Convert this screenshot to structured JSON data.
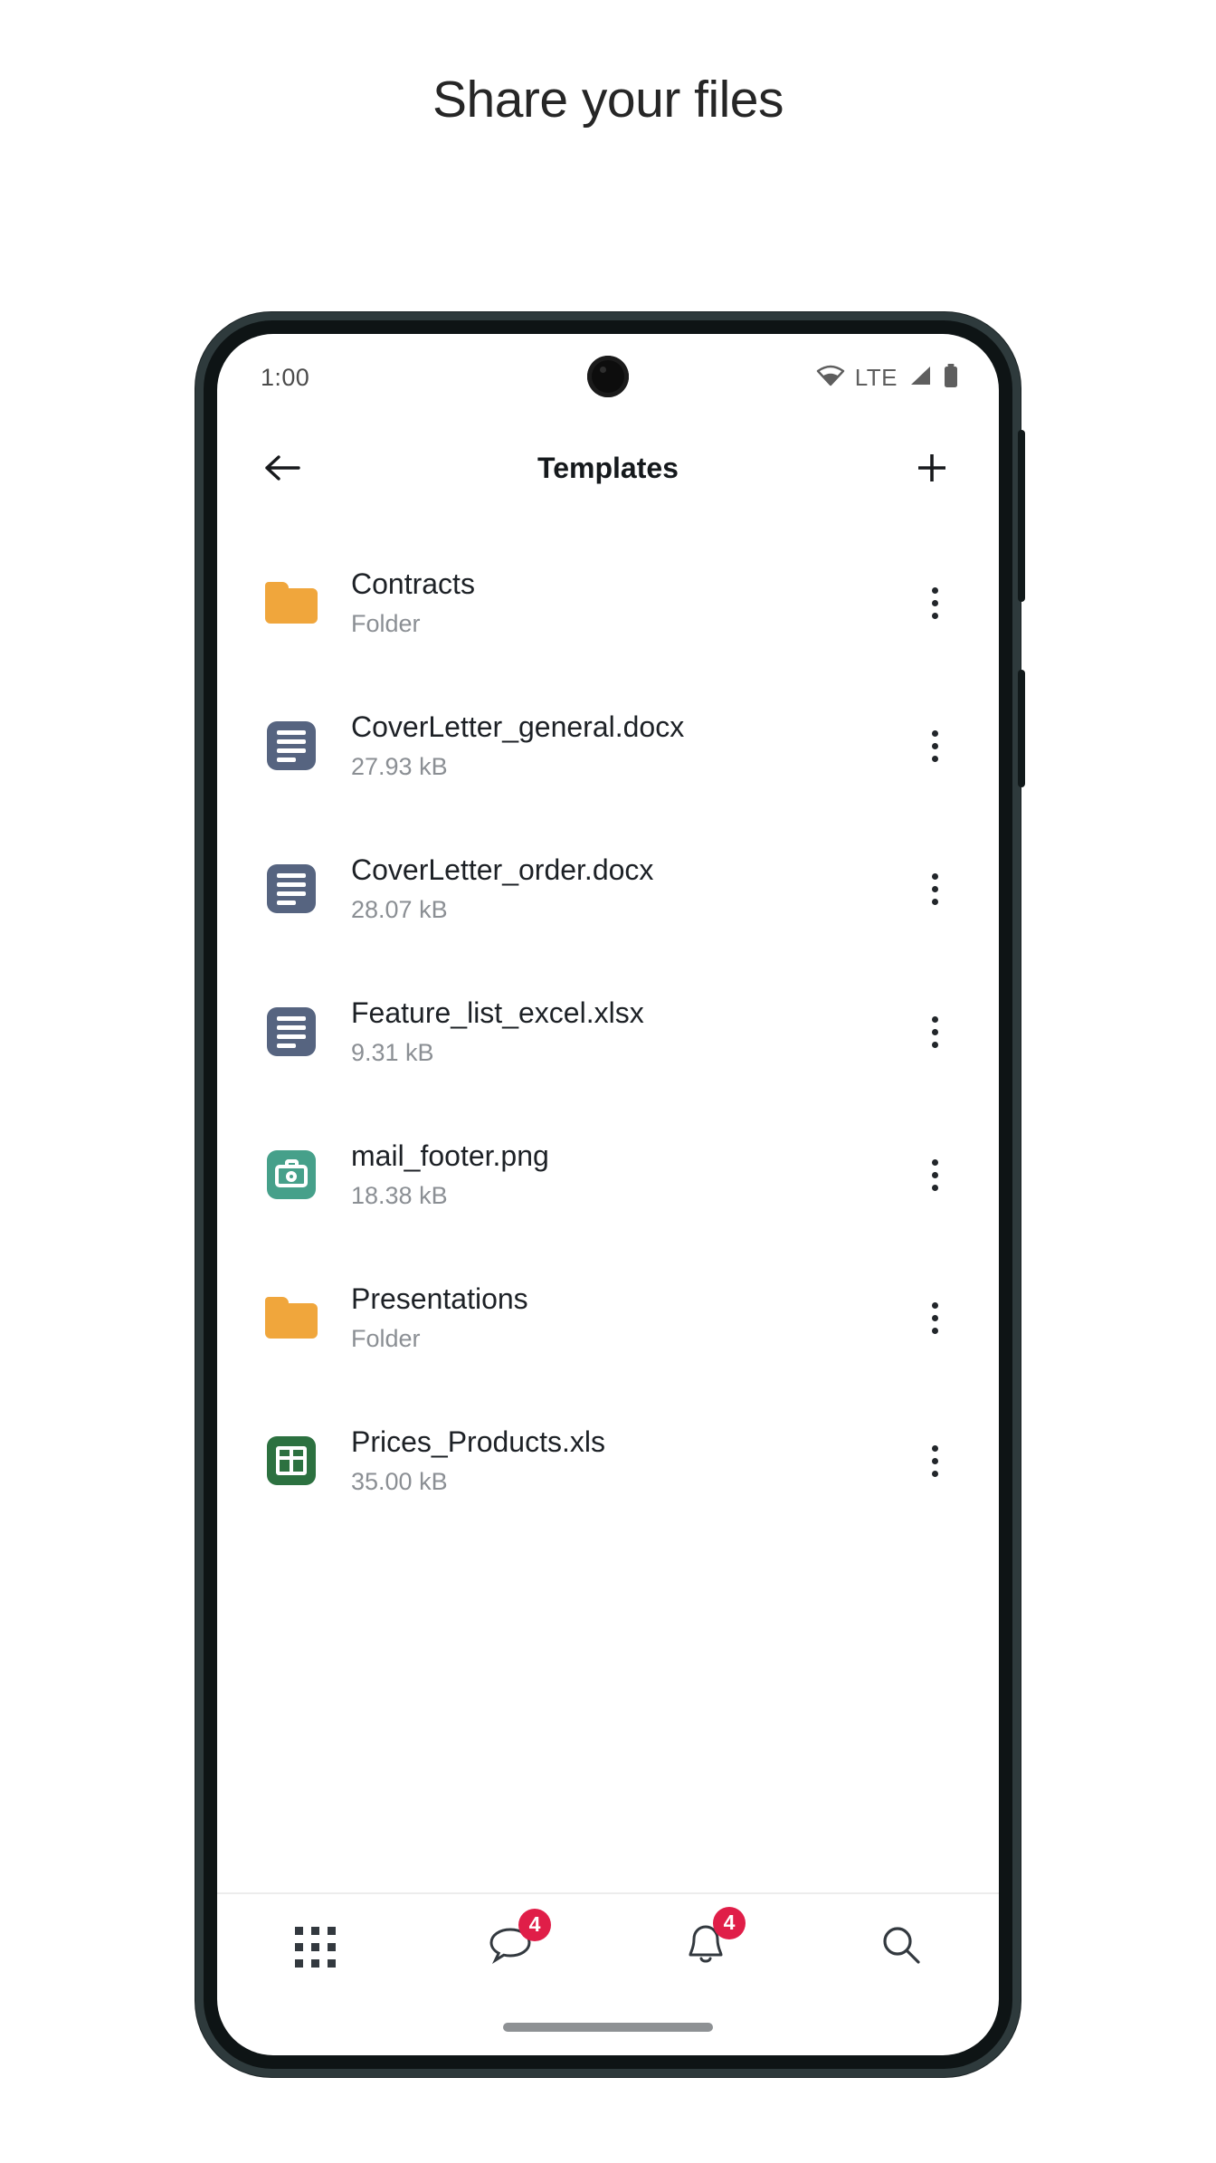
{
  "page": {
    "heading": "Share your files"
  },
  "phone": {
    "status_bar": {
      "time": "1:00",
      "network_label": "LTE",
      "icons": [
        "wifi-icon",
        "signal-icon",
        "battery-icon"
      ]
    },
    "app_bar": {
      "back_label": "back-arrow-icon",
      "title": "Templates",
      "add_label": "plus-icon"
    },
    "files": [
      {
        "name": "Contracts",
        "meta": "Folder",
        "icon": "folder",
        "color": "#F0A63C"
      },
      {
        "name": "CoverLetter_general.docx",
        "meta": "27.93 kB",
        "icon": "document",
        "color": "#566480"
      },
      {
        "name": "CoverLetter_order.docx",
        "meta": "28.07 kB",
        "icon": "document",
        "color": "#566480"
      },
      {
        "name": "Feature_list_excel.xlsx",
        "meta": "9.31 kB",
        "icon": "document",
        "color": "#566480"
      },
      {
        "name": "mail_footer.png",
        "meta": "18.38 kB",
        "icon": "image",
        "color": "#46A08A"
      },
      {
        "name": "Presentations",
        "meta": "Folder",
        "icon": "folder",
        "color": "#F0A63C"
      },
      {
        "name": "Prices_Products.xls",
        "meta": "35.00 kB",
        "icon": "spreadsheet",
        "color": "#2C7140"
      }
    ],
    "bottom_nav": [
      {
        "icon": "apps-grid-icon",
        "badge": ""
      },
      {
        "icon": "chat-bubble-icon",
        "badge": "4"
      },
      {
        "icon": "bell-icon",
        "badge": "4"
      },
      {
        "icon": "search-icon",
        "badge": ""
      }
    ],
    "colors": {
      "badge": "#E01E48",
      "accent_orange": "#F0A63C",
      "accent_green": "#2C7140",
      "accent_teal": "#46A08A",
      "accent_slate": "#566480"
    }
  }
}
